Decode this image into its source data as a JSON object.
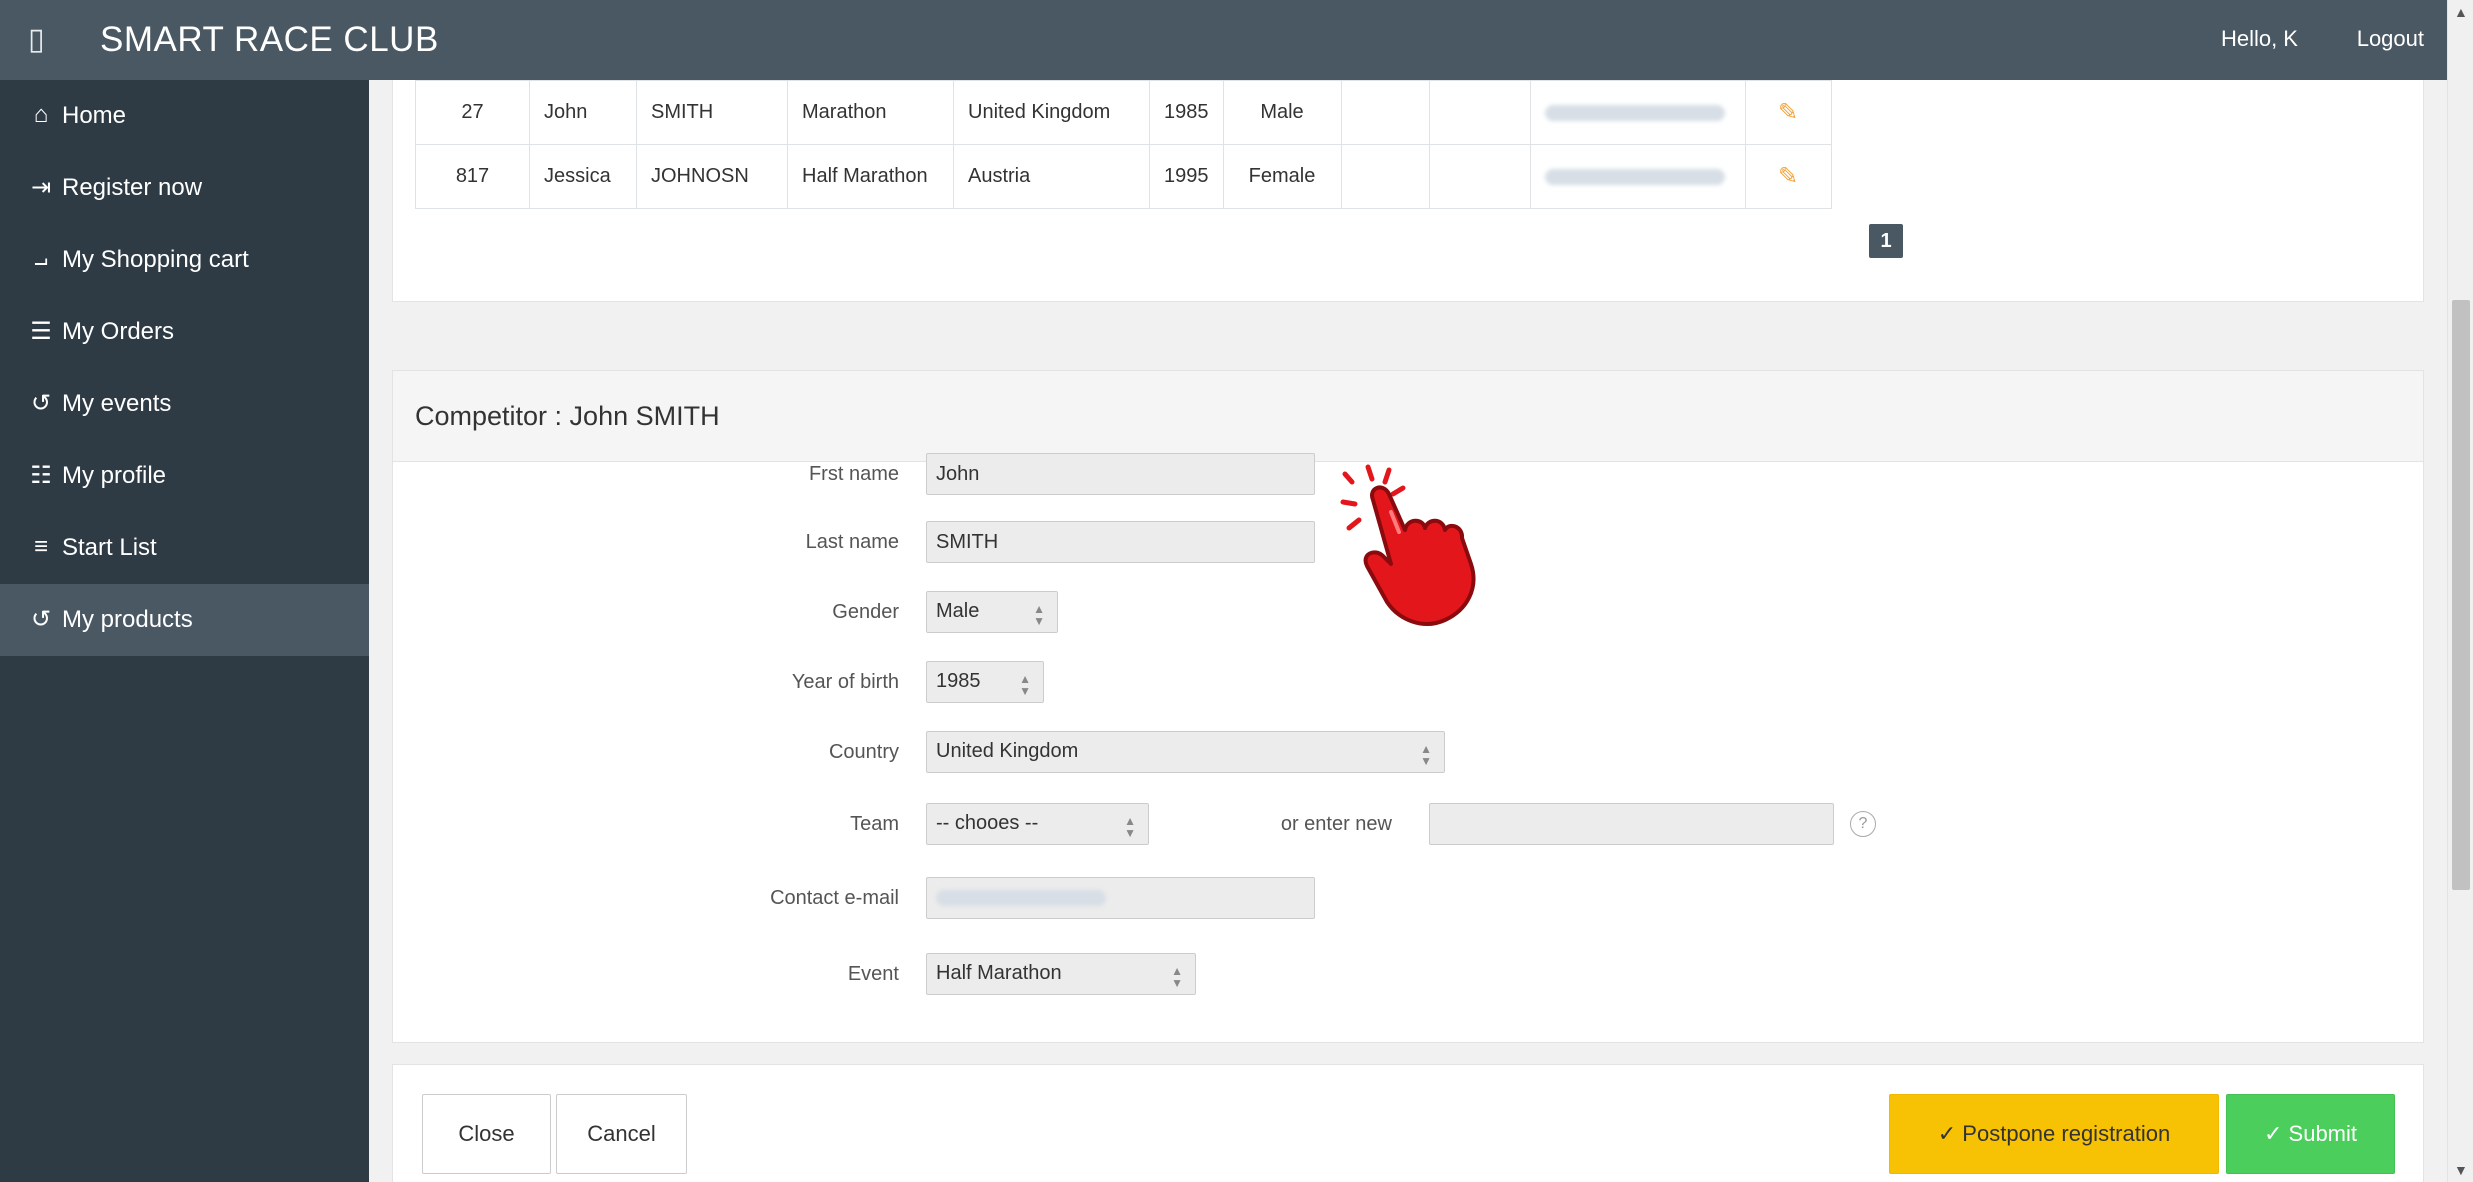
{
  "app": {
    "brand": "SMART RACE CLUB",
    "menu_glyph": "▯",
    "hello": "Hello, K",
    "logout": "Logout"
  },
  "sidebar": {
    "items": [
      {
        "label": "Home",
        "icon": "home-icon",
        "glyph": "⌂"
      },
      {
        "label": "Register now",
        "icon": "sign-in-icon",
        "glyph": "⇥"
      },
      {
        "label": "My Shopping cart",
        "icon": "cart-icon",
        "glyph": "⨼"
      },
      {
        "label": "My Orders",
        "icon": "checklist-icon",
        "glyph": "☰"
      },
      {
        "label": "My events",
        "icon": "history-icon",
        "glyph": "↺"
      },
      {
        "label": "My profile",
        "icon": "org-chart-icon",
        "glyph": "☷"
      },
      {
        "label": "Start List",
        "icon": "ordered-list-icon",
        "glyph": "≡"
      },
      {
        "label": "My products",
        "icon": "history-icon",
        "glyph": "↺",
        "active": true
      }
    ]
  },
  "table": {
    "rows": [
      {
        "num": "27",
        "first": "John",
        "last": "SMITH",
        "event": "Marathon",
        "country": "United Kingdom",
        "year": "1985",
        "gender": "Male"
      },
      {
        "num": "817",
        "first": "Jessica",
        "last": "JOHNOSN",
        "event": "Half Marathon",
        "country": "Austria",
        "year": "1995",
        "gender": "Female"
      }
    ],
    "pager": "1"
  },
  "competitor": {
    "title": "Competitor : John SMITH",
    "labels": {
      "first_name": "Frst name",
      "last_name": "Last name",
      "gender": "Gender",
      "year": "Year of birth",
      "country": "Country",
      "team": "Team",
      "or_enter_new": "or enter new",
      "email": "Contact e-mail",
      "event": "Event"
    },
    "values": {
      "first_name": "John",
      "last_name": "SMITH",
      "gender": "Male",
      "year": "1985",
      "country": "United Kingdom",
      "team": "-- chooes --",
      "new_team": "",
      "event": "Half Marathon"
    },
    "help": "?"
  },
  "buttons": {
    "close": "Close",
    "cancel": "Cancel",
    "postpone": "✓ Postpone registration",
    "submit": "✓ Submit"
  },
  "colors": {
    "topbar": "#4a5863",
    "sidebar": "#2e3b45",
    "postpone": "#f7c204",
    "submit": "#4cce5c",
    "hand": "#e3161c"
  }
}
